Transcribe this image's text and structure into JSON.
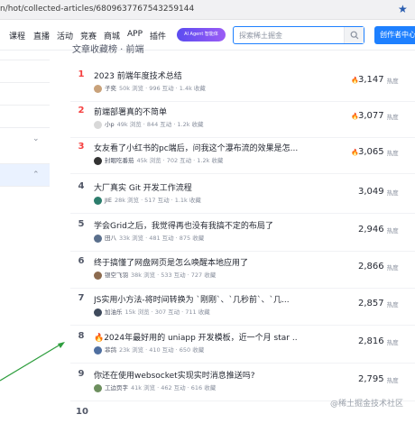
{
  "browser": {
    "url": "n/hot/collected-articles/6809637767543259144"
  },
  "nav": {
    "items": [
      "课程",
      "直播",
      "活动",
      "竞赛",
      "商城",
      "APP",
      "插件"
    ],
    "ai_badge": "AI Agent 智能体",
    "search_placeholder": "探索稀土掘金",
    "create_button": "创作者中心"
  },
  "list": {
    "title": "文章收藏榜 · 前端",
    "hot_label": "热度",
    "articles": [
      {
        "rank": "1",
        "title": "2023 前端年度技术总结",
        "author": "子奕",
        "views": "50k 浏览",
        "interactions": "996 互动",
        "collections": "1.4k 收藏",
        "hot": "3,147",
        "fire": true,
        "avatar_color": "#c9a27a"
      },
      {
        "rank": "2",
        "title": "前端部署真的不简单",
        "author": "小p",
        "views": "49k 浏览",
        "interactions": "844 互动",
        "collections": "1.2k 收藏",
        "hot": "3,077",
        "fire": true,
        "avatar_color": "#d8d8d8"
      },
      {
        "rank": "3",
        "title": "女友看了小红书的pc端后，问我这个瀑布流的效果是怎...",
        "author": "封眠吃番茄",
        "views": "45k 浏览",
        "interactions": "702 互动",
        "collections": "1.2k 收藏",
        "hot": "3,065",
        "fire": true,
        "avatar_color": "#333333"
      },
      {
        "rank": "4",
        "title": "大厂真实 Git 开发工作流程",
        "author": "JIE",
        "views": "28k 浏览",
        "interactions": "517 互动",
        "collections": "1.1k 收藏",
        "hot": "3,049",
        "fire": false,
        "avatar_color": "#2c7d6c"
      },
      {
        "rank": "5",
        "title": "学会Grid之后，我觉得再也没有我搞不定的布局了",
        "author": "田八",
        "views": "33k 浏览",
        "interactions": "481 互动",
        "collections": "875 收藏",
        "hot": "2,946",
        "fire": false,
        "avatar_color": "#5a6f8c"
      },
      {
        "rank": "6",
        "title": "终于搞懂了网盘网页是怎么唤醒本地应用了",
        "author": "银空飞羽",
        "views": "38k 浏览",
        "interactions": "533 互动",
        "collections": "727 收藏",
        "hot": "2,866",
        "fire": false,
        "avatar_color": "#8c6b4f"
      },
      {
        "rank": "7",
        "title": "JS实用小方法-将时间转换为 `刚刚`、`几秒前`、`几...",
        "author": "加油乐",
        "views": "15k 浏览",
        "interactions": "307 互动",
        "collections": "711 收藏",
        "hot": "2,857",
        "fire": false,
        "avatar_color": "#3f4a5c"
      },
      {
        "rank": "8",
        "title": "🔥2024年最好用的 uniapp 开发模板，近一个月 star ...",
        "author": "菲鸽",
        "views": "23k 浏览",
        "interactions": "410 互动",
        "collections": "650 收藏",
        "hot": "2,816",
        "fire": false,
        "avatar_color": "#4f6fa0"
      },
      {
        "rank": "9",
        "title": "你还在使用websocket实现实时消息推送吗?",
        "author": "工边页字",
        "views": "41k 浏览",
        "interactions": "462 互动",
        "collections": "616 收藏",
        "hot": "2,795",
        "fire": false,
        "avatar_color": "#6d8f5e"
      },
      {
        "rank": "10",
        "title": "",
        "author": "",
        "views": "",
        "interactions": "",
        "collections": "",
        "hot": "",
        "fire": false,
        "avatar_color": "#cccccc"
      }
    ]
  },
  "watermark": "@稀土掘金技术社区",
  "colors": {
    "accent": "#1e80ff",
    "top_rank": "#f53f3f",
    "arrow": "#2e9e3e"
  }
}
